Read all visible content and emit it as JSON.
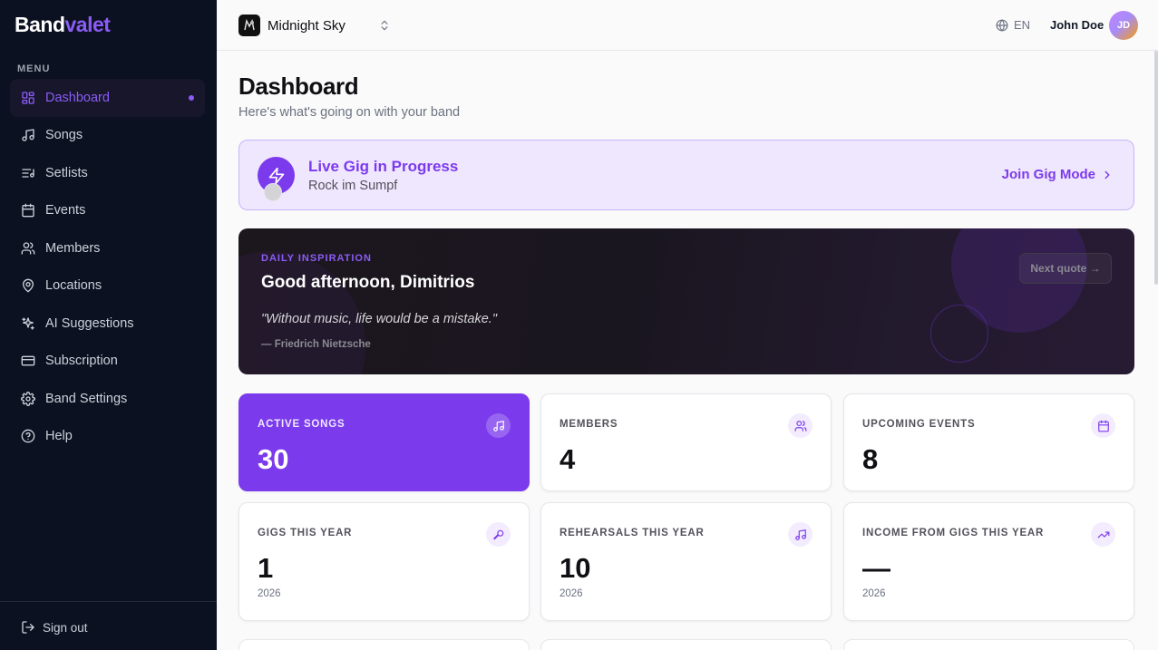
{
  "brand": {
    "name_part1": "Band",
    "name_part2": "valet"
  },
  "sidebar": {
    "menu_heading": "MENU",
    "items": [
      {
        "label": "Dashboard",
        "icon": "dashboard-grid-icon",
        "active": true
      },
      {
        "label": "Songs",
        "icon": "music-note-icon"
      },
      {
        "label": "Setlists",
        "icon": "list-music-icon"
      },
      {
        "label": "Events",
        "icon": "calendar-icon"
      },
      {
        "label": "Members",
        "icon": "users-icon"
      },
      {
        "label": "Locations",
        "icon": "map-pin-icon"
      },
      {
        "label": "AI Suggestions",
        "icon": "sparkles-icon"
      },
      {
        "label": "Subscription",
        "icon": "credit-card-icon"
      },
      {
        "label": "Band Settings",
        "icon": "gear-icon"
      },
      {
        "label": "Help",
        "icon": "help-circle-icon"
      }
    ],
    "signout_label": "Sign out"
  },
  "header": {
    "band_name": "Midnight Sky",
    "language": "EN",
    "user_name": "John Doe",
    "user_initials": "JD"
  },
  "main": {
    "title": "Dashboard",
    "subtitle": "Here's what's going on with your band",
    "gig_banner": {
      "title": "Live Gig in Progress",
      "venue": "Rock im Sumpf",
      "action_label": "Join Gig Mode"
    },
    "inspiration": {
      "label": "DAILY INSPIRATION",
      "greeting": "Good afternoon, Dimitrios",
      "quote": "\"Without music, life would be a mistake.\"",
      "author": "— Friedrich Nietzsche",
      "next_label": "Next quote →"
    },
    "stats": [
      {
        "label": "ACTIVE SONGS",
        "value": "30",
        "sub": "",
        "icon": "music-note-icon"
      },
      {
        "label": "MEMBERS",
        "value": "4",
        "sub": "",
        "icon": "users-icon"
      },
      {
        "label": "UPCOMING EVENTS",
        "value": "8",
        "sub": "",
        "icon": "calendar-icon"
      },
      {
        "label": "GIGS THIS YEAR",
        "value": "1",
        "sub": "2026",
        "icon": "microphone-icon"
      },
      {
        "label": "REHEARSALS THIS YEAR",
        "value": "10",
        "sub": "2026",
        "icon": "music-note-icon"
      },
      {
        "label": "INCOME FROM GIGS THIS YEAR",
        "value": "—",
        "sub": "2026",
        "icon": "trending-up-icon"
      }
    ]
  },
  "colors": {
    "accent": "#7c3aed",
    "sidebar_bg": "#0b1120",
    "banner_bg": "#efe7fd",
    "quote_bg": "#1c171d"
  }
}
